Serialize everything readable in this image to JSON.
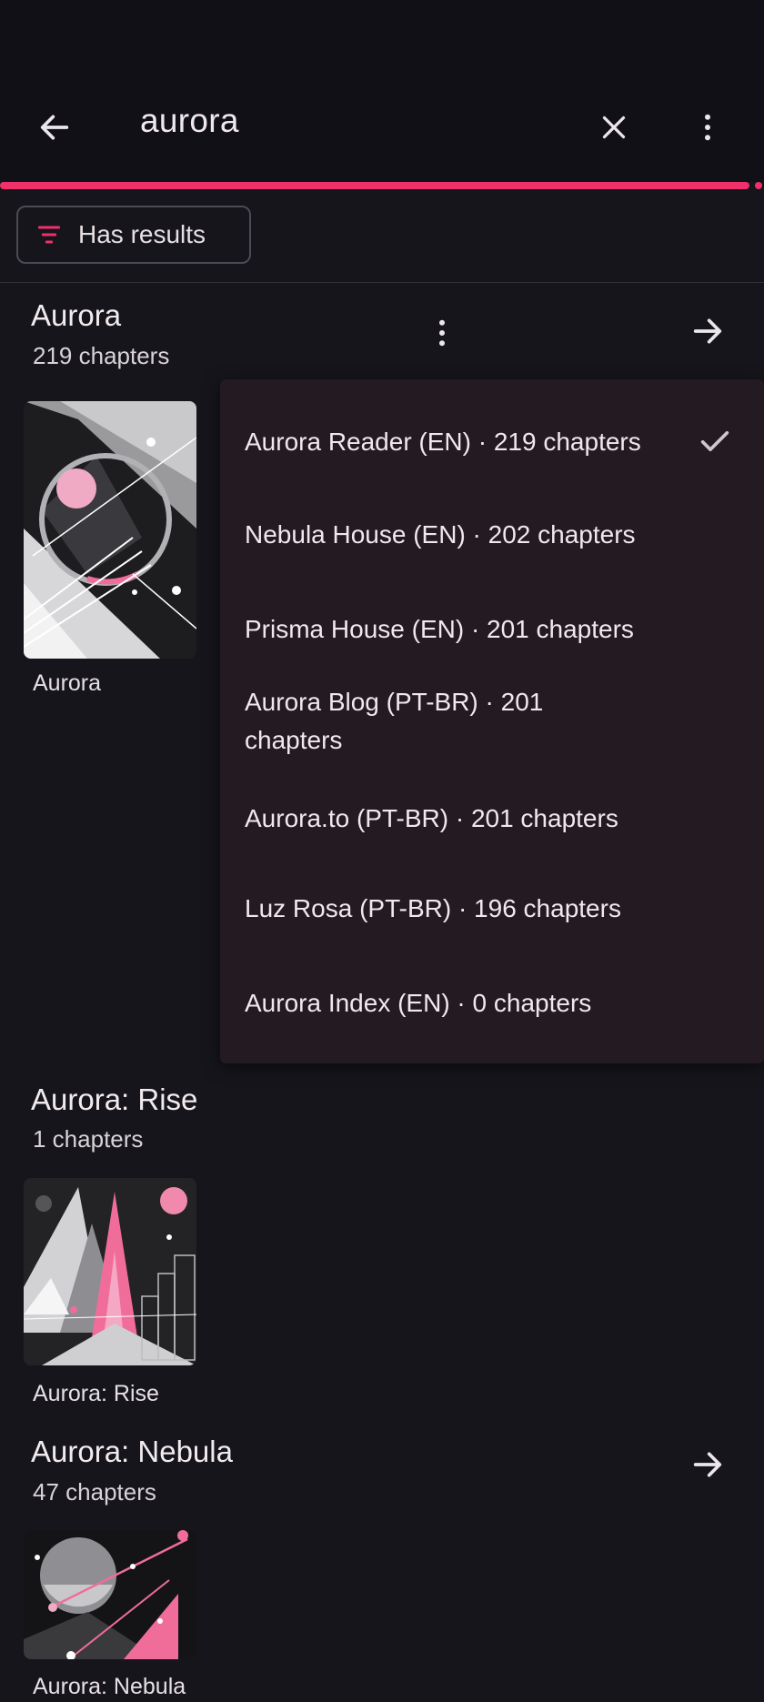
{
  "search": {
    "query": "aurora"
  },
  "filter_chip": {
    "label": "Has results"
  },
  "colors": {
    "accent": "#f0306a",
    "background": "#15151b",
    "menu_bg": "#241a22"
  },
  "icons": {
    "back": "arrow-left-icon",
    "clear": "close-icon",
    "overflow": "more-vert-icon",
    "filter": "filter-icon",
    "open": "arrow-right-icon",
    "selected": "check-icon"
  },
  "groups": [
    {
      "title": "Aurora",
      "subtitle": "219 chapters",
      "cover_label": "Aurora"
    },
    {
      "title": "Aurora: Rise",
      "subtitle": "1 chapters",
      "cover_label": "Aurora: Rise"
    },
    {
      "title": "Aurora: Nebula",
      "subtitle": "47 chapters",
      "cover_label": "Aurora: Nebula"
    }
  ],
  "source_menu": {
    "items": [
      {
        "label": "Aurora Reader (EN) · 219 chapters",
        "selected": true
      },
      {
        "label": "Nebula House (EN) · 202 chapters",
        "selected": false
      },
      {
        "label": "Prisma House (EN) · 201 chapters",
        "selected": false
      },
      {
        "label": "Aurora Blog (PT-BR) · 201 chapters",
        "selected": false
      },
      {
        "label": "Aurora.to (PT-BR) · 201 chapters",
        "selected": false
      },
      {
        "label": "Luz Rosa (PT-BR) · 196 chapters",
        "selected": false
      },
      {
        "label": "Aurora Index (EN) · 0 chapters",
        "selected": false
      }
    ]
  }
}
